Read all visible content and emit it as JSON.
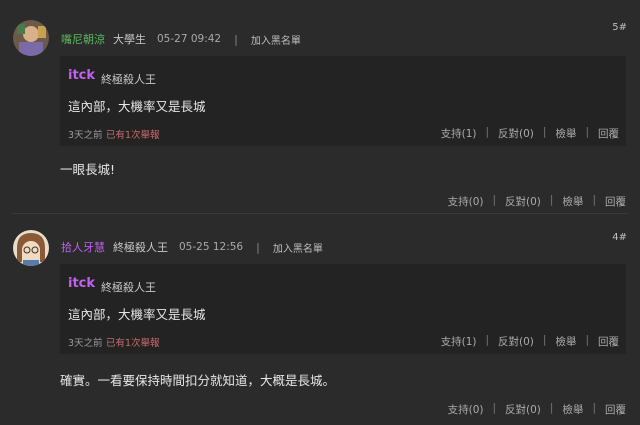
{
  "comments": [
    {
      "username": "嘴尼朝涼",
      "title": "大學生",
      "time": "05-27 09:42",
      "separator": "|",
      "blacklist": "加入黑名單",
      "floor": "5#",
      "quote": {
        "username": "itck",
        "title": "終極殺人王",
        "text": "這內部，大機率又是長城",
        "ago": "3天之前",
        "reports": "已有1次舉報",
        "support": "支持(1)",
        "oppose": "反對(0)",
        "report": "檢舉",
        "reply": "回覆"
      },
      "text": "一眼長城!",
      "support": "支持(0)",
      "oppose": "反對(0)",
      "report": "檢舉",
      "reply": "回覆"
    },
    {
      "username": "拾人牙慧",
      "title": "終極殺人王",
      "time": "05-25 12:56",
      "separator": "|",
      "blacklist": "加入黑名單",
      "floor": "4#",
      "quote": {
        "username": "itck",
        "title": "終極殺人王",
        "text": "這內部，大機率又是長城",
        "ago": "3天之前",
        "reports": "已有1次舉報",
        "support": "支持(1)",
        "oppose": "反對(0)",
        "report": "檢舉",
        "reply": "回覆"
      },
      "text": "確實。一看要保持時間扣分就知道，大概是長城。",
      "support": "支持(0)",
      "oppose": "反對(0)",
      "report": "檢舉",
      "reply": "回覆"
    }
  ],
  "action_separator": "|",
  "colors": {
    "background": "#2b2b2b",
    "quote_background": "#232323",
    "username_green": "#5cb85c",
    "username_purple": "#c061f0",
    "report_red": "#c86a6a"
  }
}
